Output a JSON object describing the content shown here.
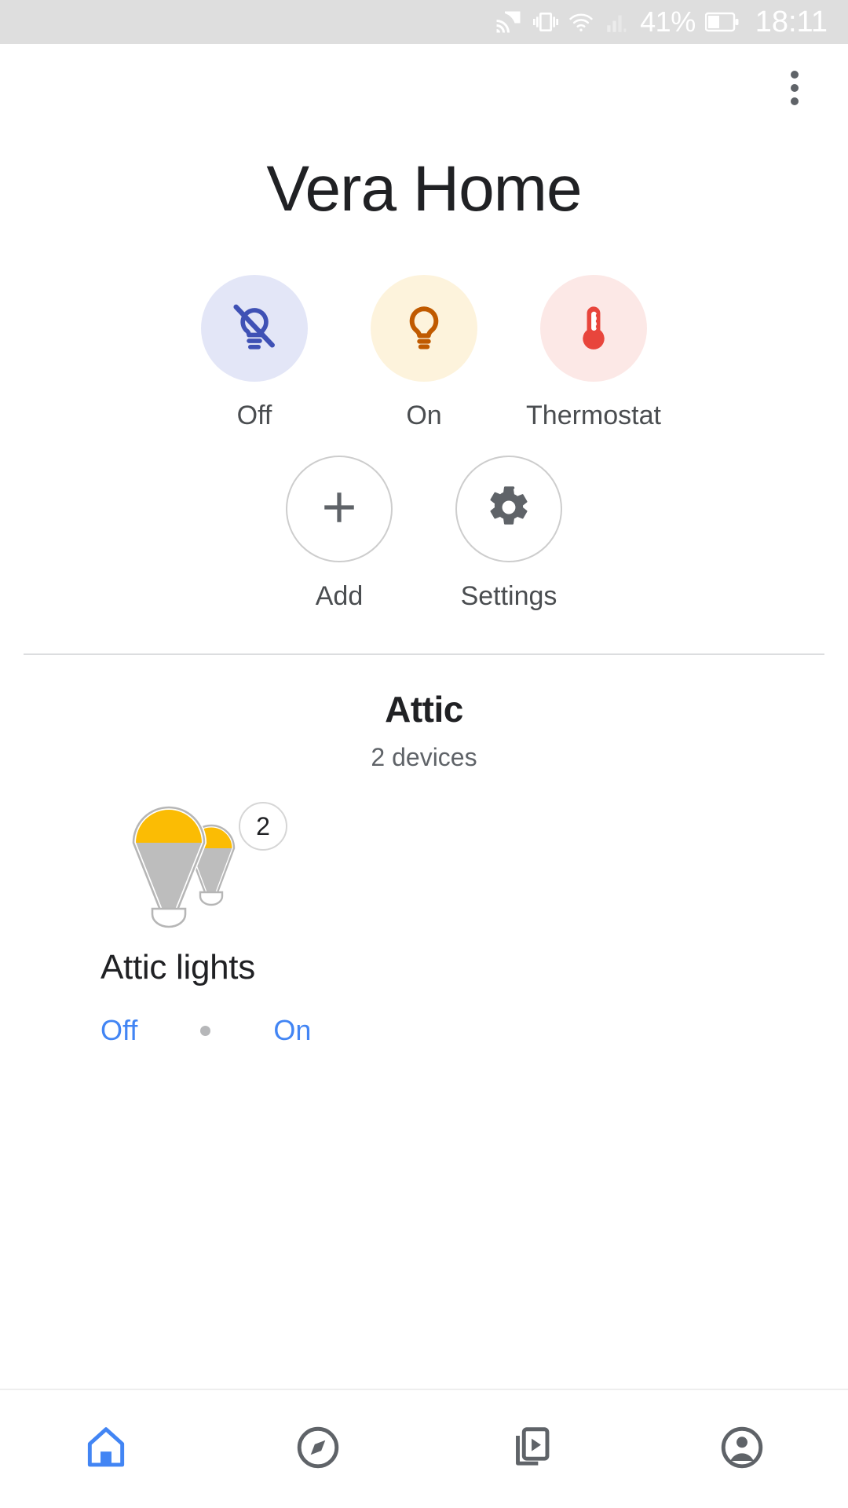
{
  "status_bar": {
    "battery_percent": "41%",
    "clock": "18:11",
    "icons": [
      "cast-icon",
      "vibrate-icon",
      "wifi-icon",
      "signal-icon",
      "battery-icon"
    ],
    "background": "#dedede",
    "foreground": "#ffffff"
  },
  "app_bar": {
    "overflow_menu": "more-options-icon"
  },
  "header": {
    "title": "Vera Home"
  },
  "quick_actions": {
    "row1": [
      {
        "label": "Off",
        "icon": "bulb-off-icon",
        "circle_color": "#e3e6f7",
        "icon_color": "#3f51b5"
      },
      {
        "label": "On",
        "icon": "bulb-on-icon",
        "circle_color": "#fdf3dc",
        "icon_color": "#c05a00"
      },
      {
        "label": "Thermostat",
        "icon": "thermometer-icon",
        "circle_color": "#fce8e6",
        "icon_color": "#e8453c"
      }
    ],
    "row2": [
      {
        "label": "Add",
        "icon": "plus-icon",
        "icon_color": "#5f6368"
      },
      {
        "label": "Settings",
        "icon": "gear-icon",
        "icon_color": "#5f6368"
      }
    ]
  },
  "room": {
    "name": "Attic",
    "device_count": "2 devices",
    "devices": [
      {
        "name": "Attic lights",
        "badge": "2",
        "icon": "light-group-icon",
        "actions": [
          {
            "label": "Off",
            "color": "#4285f4"
          },
          {
            "label": "On",
            "color": "#4285f4"
          }
        ]
      }
    ]
  },
  "bottom_nav": {
    "items": [
      {
        "icon": "home-icon",
        "name": "nav-home",
        "active": true,
        "color": "#4285f4"
      },
      {
        "icon": "explore-icon",
        "name": "nav-explore",
        "active": false,
        "color": "#5f6368"
      },
      {
        "icon": "media-icon",
        "name": "nav-media",
        "active": false,
        "color": "#5f6368"
      },
      {
        "icon": "account-icon",
        "name": "nav-account",
        "active": false,
        "color": "#5f6368"
      }
    ]
  }
}
